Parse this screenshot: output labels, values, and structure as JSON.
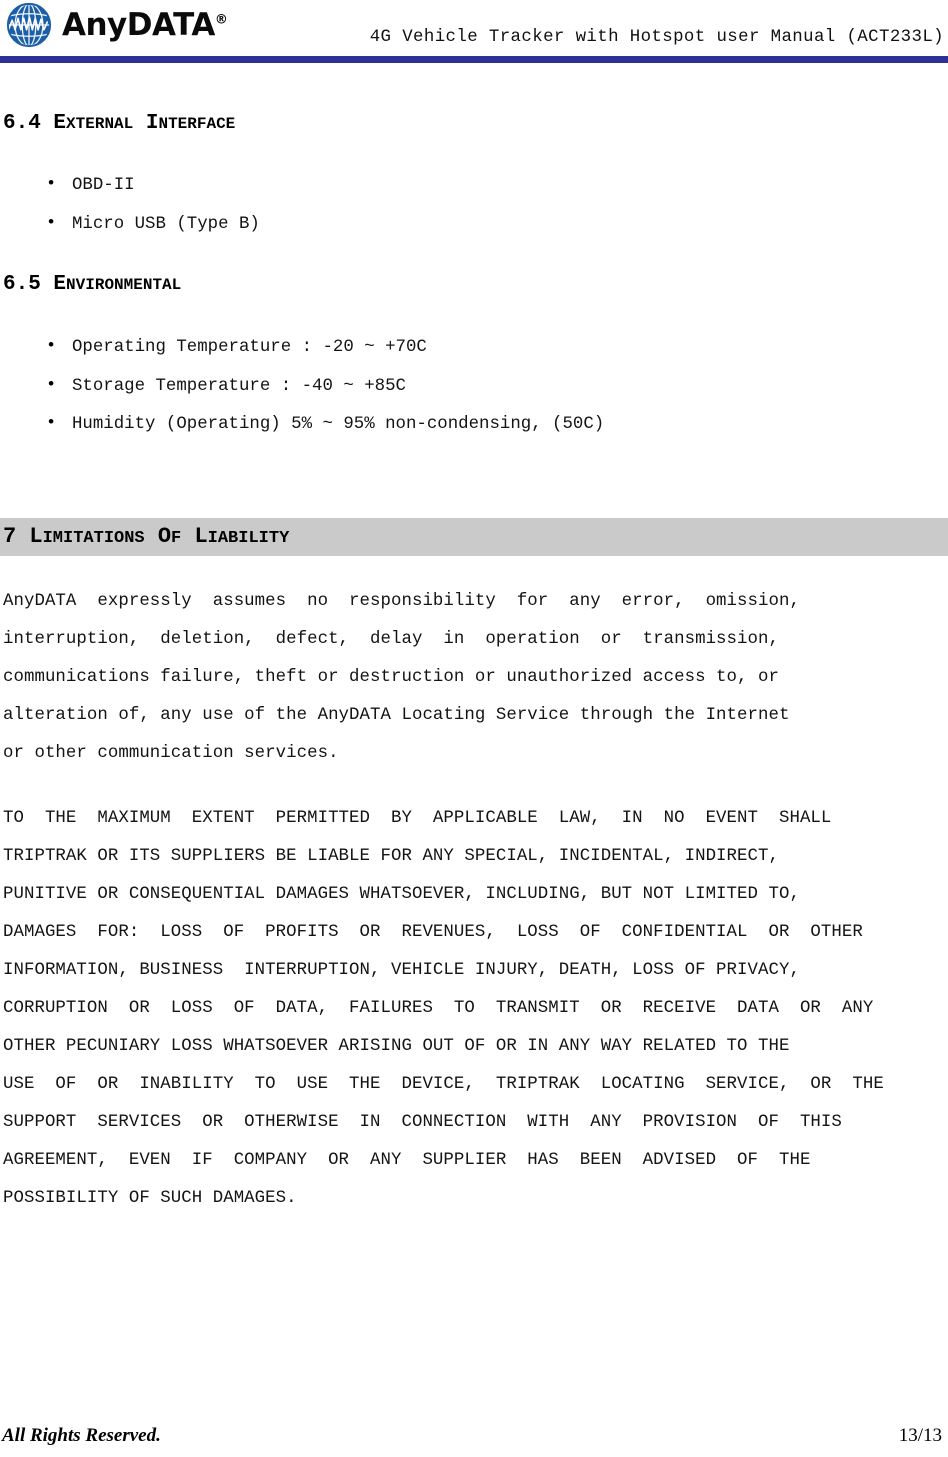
{
  "header": {
    "brand_name": "AnyDATA",
    "brand_trademark": "®",
    "logo_icon": "globe-waveform-icon",
    "title": "4G Vehicle Tracker with Hotspot user Manual (ACT233L)",
    "rule_color": "#2e3192"
  },
  "sections": {
    "s64": {
      "number": "6.4",
      "title_first": "E",
      "title_rest": "XTERNAL",
      "title_second_first": "I",
      "title_second_rest": "NTERFACE",
      "full_title": "6.4 EXTERNAL INTERFACE",
      "bullets": [
        "OBD-II",
        "Micro USB (Type B)"
      ]
    },
    "s65": {
      "number": "6.5",
      "title_first": "E",
      "title_rest": "NVIRONMENTAL",
      "full_title": "6.5 ENVIRONMENTAL",
      "bullets": [
        "Operating Temperature : -20 ~ +70C",
        "Storage Temperature : -40 ~ +85C",
        "Humidity (Operating) 5% ~ 95% non-condensing, (50C)"
      ]
    },
    "s7": {
      "number": "7",
      "w1_first": "L",
      "w1_rest": "IMITATIONS",
      "w2_first": "O",
      "w2_rest": "F",
      "w3_first": "L",
      "w3_rest": "IABILITY",
      "full_title": "7 LIMITATIONS OF LIABILITY",
      "band_color": "#cacaca",
      "paragraph1": {
        "lines": [
          "AnyDATA  expressly  assumes  no  responsibility  for  any  error,  omission,",
          "interruption,  deletion,  defect,  delay  in  operation  or  transmission,",
          "communications failure, theft or destruction or unauthorized access to, or",
          "alteration of, any use of the AnyDATA Locating Service through the Internet",
          "or other communication services."
        ]
      },
      "paragraph2": {
        "lines": [
          "TO  THE  MAXIMUM  EXTENT  PERMITTED  BY  APPLICABLE  LAW,  IN  NO  EVENT  SHALL",
          "TRIPTRAK OR ITS SUPPLIERS BE LIABLE FOR ANY SPECIAL, INCIDENTAL, INDIRECT,",
          "PUNITIVE OR CONSEQUENTIAL DAMAGES WHATSOEVER, INCLUDING, BUT NOT LIMITED TO,",
          "DAMAGES  FOR:  LOSS  OF  PROFITS  OR  REVENUES,  LOSS  OF  CONFIDENTIAL  OR  OTHER",
          "INFORMATION, BUSINESS  INTERRUPTION, VEHICLE INJURY, DEATH, LOSS OF PRIVACY,",
          "CORRUPTION  OR  LOSS  OF  DATA,  FAILURES  TO  TRANSMIT  OR  RECEIVE  DATA  OR  ANY",
          "OTHER PECUNIARY LOSS WHATSOEVER ARISING OUT OF OR IN ANY WAY RELATED TO THE",
          "USE  OF  OR  INABILITY  TO  USE  THE  DEVICE,  TRIPTRAK  LOCATING  SERVICE,  OR  THE",
          "SUPPORT  SERVICES  OR  OTHERWISE  IN  CONNECTION  WITH  ANY  PROVISION  OF  THIS",
          "AGREEMENT,  EVEN  IF  COMPANY  OR  ANY  SUPPLIER  HAS  BEEN  ADVISED  OF  THE",
          "POSSIBILITY OF SUCH DAMAGES."
        ]
      }
    }
  },
  "footer": {
    "left_text": "All Rights Reserved.",
    "page_number": "13/13"
  }
}
